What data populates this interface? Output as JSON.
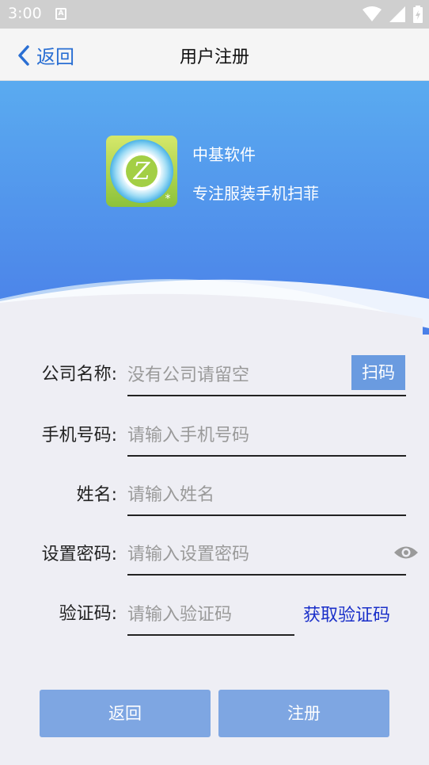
{
  "status_bar": {
    "time": "3:00",
    "notification_letter": "A"
  },
  "nav": {
    "back_label": "返回",
    "title": "用户注册"
  },
  "brand": {
    "name": "中基软件",
    "slogan": "专注服装手机扫菲",
    "logo_letter": "Z"
  },
  "form": {
    "company": {
      "label": "公司名称:",
      "placeholder": "没有公司请留空",
      "scan_label": "扫码"
    },
    "phone": {
      "label": "手机号码:",
      "placeholder": "请输入手机号码"
    },
    "name": {
      "label": "姓名:",
      "placeholder": "请输入姓名"
    },
    "password": {
      "label": "设置密码:",
      "placeholder": "请输入设置密码"
    },
    "code": {
      "label": "验证码:",
      "placeholder": "请输入验证码",
      "get_code_label": "获取验证码"
    }
  },
  "buttons": {
    "back": "返回",
    "register": "注册"
  },
  "colors": {
    "accent": "#2a6fd3",
    "banner_top": "#5aabf0",
    "banner_bottom": "#4a7fe8",
    "button": "#7ea6e2",
    "link": "#1a2fc9"
  }
}
